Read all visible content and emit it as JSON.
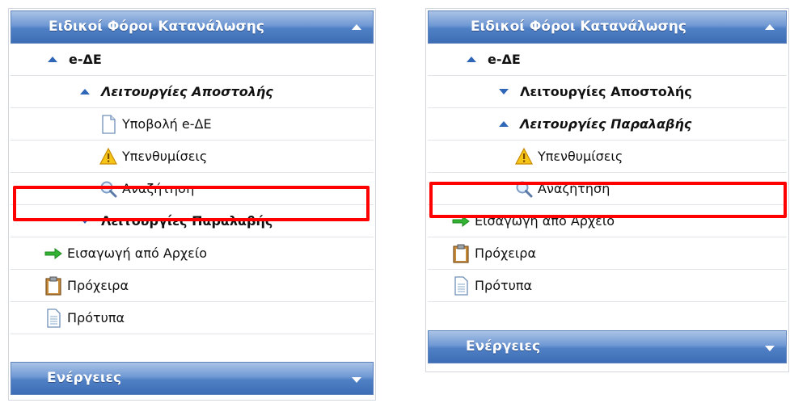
{
  "left_panel": {
    "header": "Ειδικοί Φόροι Κατανάλωσης",
    "edde": "e-ΔΕ",
    "send_ops": "Λειτουργίες Αποστολής",
    "submit": "Υποβολή e-ΔΕ",
    "reminders": "Υπενθυμίσεις",
    "search": "Αναζήτηση",
    "receive_ops": "Λειτουργίες Παραλαβής",
    "import_file": "Εισαγωγή από Αρχείο",
    "drafts": "Πρόχειρα",
    "templates": "Πρότυπα",
    "actions": "Ενέργειες"
  },
  "right_panel": {
    "header": "Ειδικοί Φόροι Κατανάλωσης",
    "edde": "e-ΔΕ",
    "send_ops": "Λειτουργίες Αποστολής",
    "receive_ops": "Λειτουργίες Παραλαβής",
    "reminders": "Υπενθυμίσεις",
    "search": "Αναζήτηση",
    "import_file": "Εισαγωγή από Αρχείο",
    "drafts": "Πρόχειρα",
    "templates": "Πρότυπα",
    "actions": "Ενέργειες"
  },
  "colors": {
    "header_blue": "#4f7fc4",
    "arrow_blue": "#2f66b8",
    "highlight_red": "#ff0000"
  }
}
